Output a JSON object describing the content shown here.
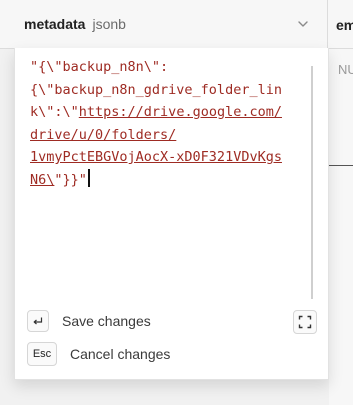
{
  "column": {
    "name": "metadata",
    "type": "jsonb"
  },
  "next_column": {
    "name_partial": "em",
    "cell_partial": "NU"
  },
  "editor": {
    "lines": [
      "\"{\\\"backup_n8n\\\":",
      "{\\\"backup_n8n_gdrive_folder_lin",
      "k\\\":\\\"",
      "https://drive.google.com/",
      "drive/u/0/folders/",
      "1vmyPctEBGVojAocX-xD0F321VDvKgs",
      "N6\\",
      "\"}}\""
    ]
  },
  "actions": {
    "save": {
      "key": "⏎",
      "label": "Save changes"
    },
    "cancel": {
      "key": "Esc",
      "label": "Cancel changes"
    }
  },
  "icons": {
    "column_menu": "chevron-down-icon",
    "expand": "expand-icon",
    "enter": "enter-key-icon"
  },
  "colors": {
    "json_string": "#9e2b23",
    "panel_bg": "#ffffff",
    "header_bg": "#f7f7f7"
  }
}
